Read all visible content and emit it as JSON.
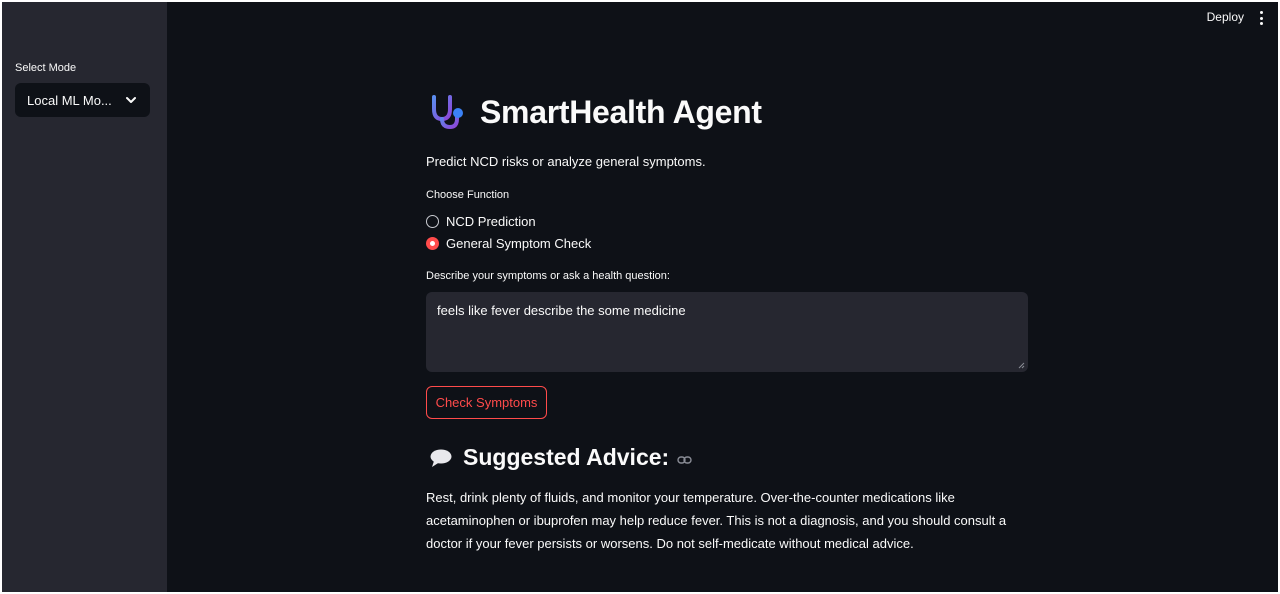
{
  "sidebar": {
    "mode_label": "Select Mode",
    "mode_value": "Local ML Mo..."
  },
  "topbar": {
    "deploy_label": "Deploy"
  },
  "main": {
    "title": "SmartHealth Agent",
    "subtitle": "Predict NCD risks or analyze general symptoms.",
    "function_label": "Choose Function",
    "options": [
      {
        "label": "NCD Prediction",
        "selected": false
      },
      {
        "label": "General Symptom Check",
        "selected": true
      }
    ],
    "input_label": "Describe your symptoms or ask a health question:",
    "input_value": "feels like fever describe the some medicine",
    "button_label": "Check Symptoms",
    "advice_heading": "Suggested Advice:",
    "advice_text": "Rest, drink plenty of fluids, and monitor your temperature. Over-the-counter medications like acetaminophen or ibuprofen may help reduce fever. This is not a diagnosis, and you should consult a doctor if your fever persists or worsens. Do not self-medicate without medical advice."
  },
  "colors": {
    "background": "#0e1117",
    "sidebar": "#262730",
    "accent": "#ff4b4b"
  },
  "icons": [
    "chevron-down-icon",
    "menu-dots-icon",
    "stethoscope-icon",
    "speech-bubble-icon",
    "link-icon"
  ]
}
